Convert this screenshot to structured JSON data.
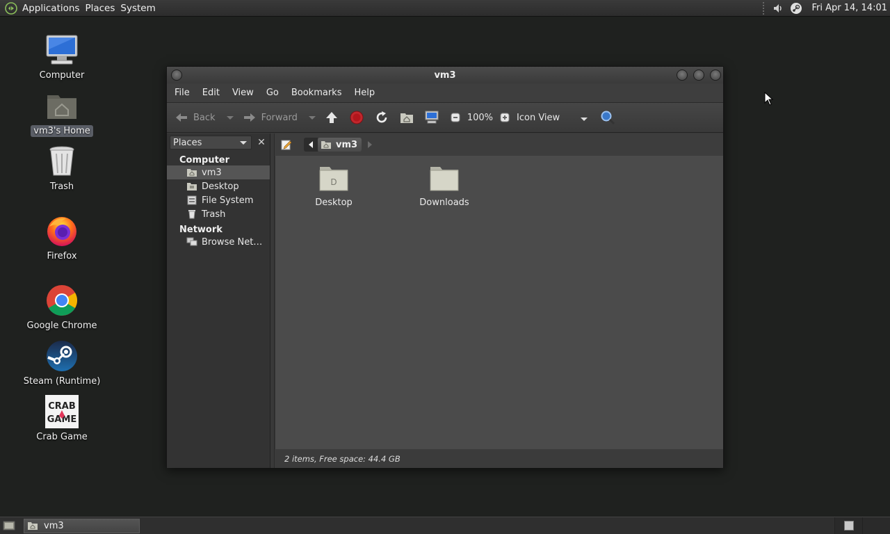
{
  "top_panel": {
    "menus": [
      "Applications",
      "Places",
      "System"
    ],
    "clock": "Fri Apr 14, 14:01",
    "tray_icons": [
      "volume-icon",
      "steam-tray-icon"
    ]
  },
  "desktop_icons": [
    {
      "label": "Computer",
      "icon": "computer-icon"
    },
    {
      "label": "vm3's Home",
      "icon": "home-folder-icon",
      "selected": true
    },
    {
      "label": "Trash",
      "icon": "trash-icon"
    },
    {
      "label": "Firefox",
      "icon": "firefox-icon"
    },
    {
      "label": "Google Chrome",
      "icon": "chrome-icon"
    },
    {
      "label": "Steam (Runtime)",
      "icon": "steam-icon"
    },
    {
      "label": "Crab Game",
      "icon": "crab-game-icon",
      "logo_text": "CRAB GAME"
    }
  ],
  "window": {
    "title": "vm3",
    "menubar": [
      "File",
      "Edit",
      "View",
      "Go",
      "Bookmarks",
      "Help"
    ],
    "toolbar": {
      "back": "Back",
      "forward": "Forward",
      "zoom": "100%",
      "view_mode": "Icon View"
    },
    "sidebar": {
      "selector": "Places",
      "sections": [
        {
          "title": "Computer",
          "items": [
            {
              "label": "vm3",
              "icon": "home-icon",
              "selected": true
            },
            {
              "label": "Desktop",
              "icon": "desktop-folder-icon"
            },
            {
              "label": "File System",
              "icon": "drive-icon"
            },
            {
              "label": "Trash",
              "icon": "trash-icon"
            }
          ]
        },
        {
          "title": "Network",
          "items": [
            {
              "label": "Browse Net…",
              "icon": "network-icon"
            }
          ]
        }
      ]
    },
    "location": {
      "crumb": "vm3"
    },
    "files": [
      {
        "name": "Desktop",
        "icon": "desktop-folder-icon"
      },
      {
        "name": "Downloads",
        "icon": "folder-icon"
      }
    ],
    "status": "2 items, Free space: 44.4 GB"
  },
  "bottom_panel": {
    "task": "vm3"
  }
}
